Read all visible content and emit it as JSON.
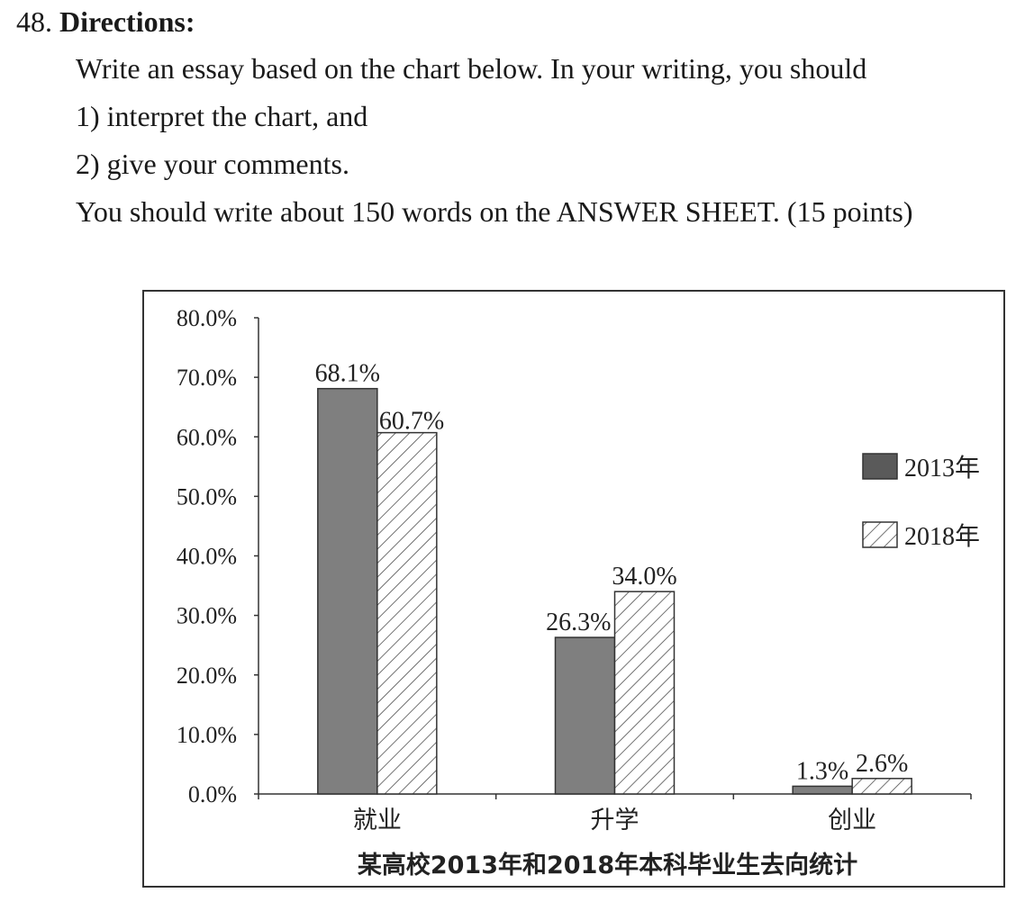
{
  "question": {
    "number": "48.",
    "heading": "Directions:",
    "lines": [
      "Write an essay based on the chart below. In your writing, you should",
      "1) interpret the chart, and",
      "2) give your comments.",
      "You should write about 150 words on the ANSWER SHEET. (15 points)"
    ]
  },
  "chart_data": {
    "type": "bar",
    "title": "某高校2013年和2018年本科毕业生去向统计",
    "categories": [
      "就业",
      "升学",
      "创业"
    ],
    "series": [
      {
        "name": "2013年",
        "values": [
          68.1,
          26.3,
          1.3
        ],
        "labels": [
          "68.1%",
          "26.3%",
          "1.3%"
        ],
        "fill": "solid",
        "color": "#7f7f7f"
      },
      {
        "name": "2018年",
        "values": [
          60.7,
          34.0,
          2.6
        ],
        "labels": [
          "60.7%",
          "34.0%",
          "2.6%"
        ],
        "fill": "hatched",
        "color": "#ffffff"
      }
    ],
    "ylim": [
      0,
      80
    ],
    "yticks": [
      "0.0%",
      "10.0%",
      "20.0%",
      "30.0%",
      "40.0%",
      "50.0%",
      "60.0%",
      "70.0%",
      "80.0%"
    ],
    "xlabel": "",
    "ylabel": "",
    "legend": "right",
    "grid": false
  }
}
